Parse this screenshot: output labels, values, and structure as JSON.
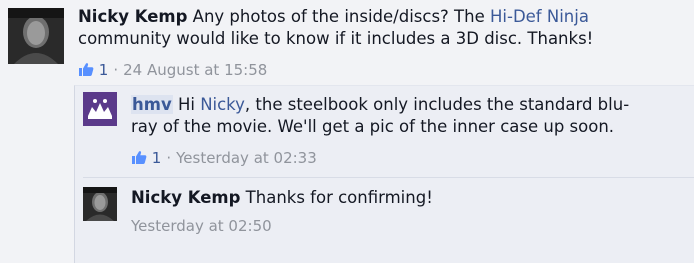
{
  "comments": [
    {
      "author": "Nicky Kemp",
      "text_before": " Any photos of the inside/discs? The ",
      "link": "Hi-Def Ninja",
      "text_after": " community would like to know if it includes a 3D disc. Thanks!",
      "likes": "1",
      "timestamp": "24 August at 15:58"
    }
  ],
  "replies": [
    {
      "author": "hmv",
      "text_before": " Hi ",
      "mention": "Nicky",
      "text_after": ", the steelbook only includes the standard blu-ray of the movie. We'll get a pic of the inner case up soon.",
      "likes": "1",
      "timestamp": "Yesterday at 02:33"
    },
    {
      "author": "Nicky Kemp",
      "text": " Thanks for confirming!",
      "timestamp": "Yesterday at 02:50"
    }
  ],
  "icons": {
    "like": "thumbs-up-icon",
    "avatar_user": "user-avatar",
    "avatar_hmv": "hmv-logo"
  },
  "colors": {
    "link": "#3b5998",
    "meta": "#90949c",
    "background": "#f2f3f6"
  }
}
